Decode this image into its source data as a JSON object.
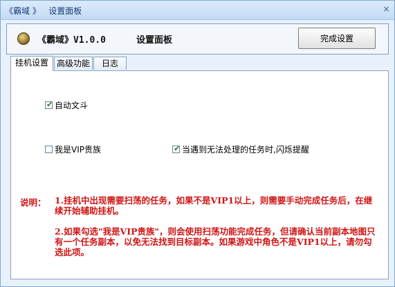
{
  "window": {
    "title": "《霸域 》   设置面板",
    "close_glyph": "×"
  },
  "header": {
    "app_name": "《霸域》V1.0.0",
    "panel_title": "设置面板",
    "finish_button": "完成设置"
  },
  "tabs": [
    {
      "label": "挂机设置",
      "active": true
    },
    {
      "label": "高级功能",
      "active": false
    },
    {
      "label": "日志",
      "active": false
    }
  ],
  "options": {
    "auto_fight": {
      "label": "自动文斗",
      "checked": true
    },
    "vip": {
      "label": "我是VIP贵族",
      "checked": false
    },
    "flash_alert": {
      "label": "当遇到无法处理的任务时,闪烁提醒",
      "checked": true
    }
  },
  "notes": {
    "label": "说明：",
    "note1": "1.挂机中出现需要扫荡的任务，如果不是VIP1以上，则需要手动完成任务后，在继续开始辅助挂机。",
    "note2": "2.如果勾选\"我是VIP贵族\"，则会使用扫荡功能完成任务，但请确认当前副本地图只有一个任务副本，以免无法找到目标副本。如果游戏中角色不是VIP1以上，请勿勾选此项。"
  },
  "colors": {
    "note_red": "#d11414",
    "check_green": "#1c7d1c",
    "title_blue": "#1b3e77"
  },
  "icons": {
    "logo": "game-logo-icon",
    "check": "checkmark-icon"
  }
}
